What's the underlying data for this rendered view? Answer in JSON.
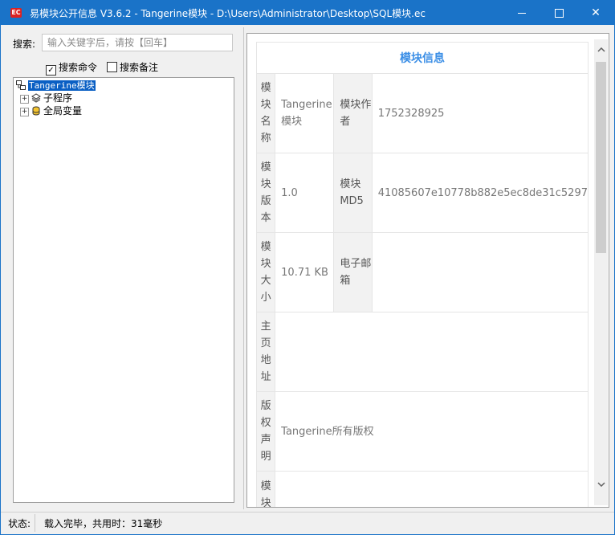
{
  "window": {
    "title": "易模块公开信息 V3.6.2 - Tangerine模块 - D:\\Users\\Administrator\\Desktop\\SQL模块.ec",
    "app_icon_text": "EC",
    "minimize": "",
    "maximize": "",
    "close": "✕"
  },
  "search": {
    "label": "搜索:",
    "placeholder": "输入关键字后，请按【回车】",
    "option_commands": {
      "label": "搜索命令",
      "checked": true
    },
    "option_notes": {
      "label": "搜索备注",
      "checked": false
    }
  },
  "tree": {
    "root": "Tangerine模块",
    "children": [
      {
        "label": "子程序",
        "icon": "subroutine-icon"
      },
      {
        "label": "全局变量",
        "icon": "global-variable-icon"
      }
    ]
  },
  "info": {
    "header": "模块信息",
    "rows": [
      {
        "label": "模块名称",
        "value": "Tangerine模块",
        "label2": "模块作者",
        "value2": "1752328925"
      },
      {
        "label": "模块版本",
        "value": "1.0",
        "label2": "模块MD5",
        "value2": "41085607e10778b882e5ec8de31c5297"
      },
      {
        "label": "模块大小",
        "value": "10.71 KB",
        "label2": "电子邮箱",
        "value2": ""
      },
      {
        "label": "主页地址",
        "value": ""
      },
      {
        "label": "版权声明",
        "value": "Tangerine所有版权"
      },
      {
        "label": "模块",
        "value": ""
      }
    ]
  },
  "status": {
    "label": "状态:",
    "text": "载入完毕，共用时：31毫秒"
  },
  "colors": {
    "titlebar": "#1a73c8",
    "header_text": "#3a8ee6",
    "tree_selection": "#0a5fc4"
  }
}
